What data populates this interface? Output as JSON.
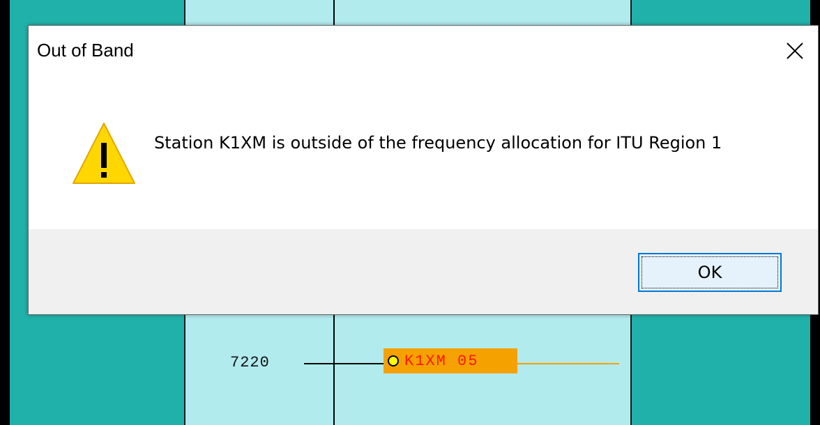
{
  "background": {
    "frequency_label": "7220",
    "spot_label": "K1XM 05",
    "colors": {
      "teal": "#20b2aa",
      "band": "#b2ebee",
      "spot": "#f5a100",
      "spot_text": "#ff1a00"
    }
  },
  "dialog": {
    "title": "Out of Band",
    "message": "Station K1XM is outside of the frequency allocation for ITU Region 1",
    "icon": "warning-icon",
    "ok_label": "OK",
    "close_icon": "close-icon",
    "accent": "#0078d7"
  }
}
